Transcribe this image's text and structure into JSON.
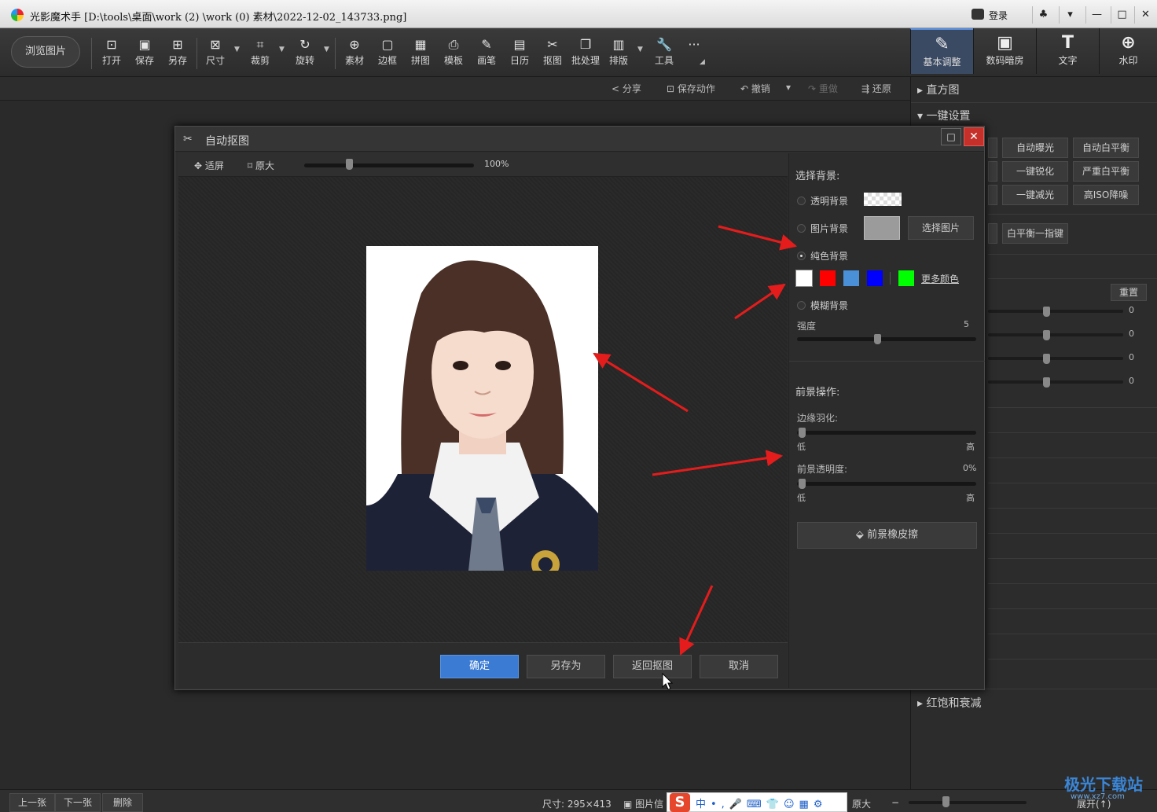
{
  "titlebar": {
    "title": "光影魔术手 [D:\\tools\\桌面\\work (2) \\work (0) 素材\\2022-12-02_143733.png]",
    "login": "登录",
    "buttons": [
      "♣",
      "▾",
      "—",
      "□",
      "✕"
    ]
  },
  "toolbar": {
    "browse": "浏览图片",
    "tools": [
      {
        "label": "打开",
        "icon": "⊡"
      },
      {
        "label": "保存",
        "icon": "▣"
      },
      {
        "label": "另存",
        "icon": "⊞"
      },
      {
        "label": "尺寸",
        "icon": "⊠"
      },
      {
        "label": "裁剪",
        "icon": "⌗"
      },
      {
        "label": "旋转",
        "icon": "↻"
      },
      {
        "label": "素材",
        "icon": "⊕"
      },
      {
        "label": "边框",
        "icon": "▢"
      },
      {
        "label": "拼图",
        "icon": "▦"
      },
      {
        "label": "模板",
        "icon": "⎙"
      },
      {
        "label": "画笔",
        "icon": "✎"
      },
      {
        "label": "日历",
        "icon": "▤"
      },
      {
        "label": "抠图",
        "icon": "✂"
      },
      {
        "label": "批处理",
        "icon": "❐"
      },
      {
        "label": "排版",
        "icon": "▥"
      },
      {
        "label": "工具",
        "icon": "🔧"
      },
      {
        "label": "",
        "icon": "···"
      }
    ],
    "tabs": [
      {
        "label": "基本调整",
        "icon": "✎"
      },
      {
        "label": "数码暗房",
        "icon": "▣"
      },
      {
        "label": "文字",
        "icon": "T"
      },
      {
        "label": "水印",
        "icon": "⊕"
      }
    ]
  },
  "subbar": {
    "share": "分享",
    "save_action": "保存动作",
    "undo": "撤销",
    "redo": "重做",
    "restore": "还原"
  },
  "right_panel": {
    "histogram": "直方图",
    "one_click": "一键设置",
    "buttons": [
      "自动曝光",
      "自动白平衡",
      "一键锐化",
      "严重白平衡",
      "一键减光",
      "高ISO降噪",
      "白平衡一指键"
    ],
    "reset": "重置",
    "slider_values": [
      "0",
      "0",
      "0",
      "0"
    ],
    "red_sat": "红饱和衰减"
  },
  "dialog": {
    "title": "自动抠图",
    "fit": "适屏",
    "original": "原大",
    "zoom_percent": "100%",
    "zoom_level": 0.25,
    "buttons": {
      "ok": "确定",
      "save_as": "另存为",
      "back": "返回抠图",
      "cancel": "取消"
    },
    "right": {
      "select_bg": "选择背景:",
      "transparent_bg": "透明背景",
      "image_bg": "图片背景",
      "choose_image": "选择图片",
      "solid_bg": "纯色背景",
      "colors": [
        "#ffffff",
        "#ff0000",
        "#4a90d9",
        "#0000ff",
        "#00ff00"
      ],
      "more_colors": "更多颜色",
      "blur_bg": "模糊背景",
      "strength": "强度",
      "strength_value": "5",
      "fg_ops": "前景操作:",
      "feather": "边缘羽化:",
      "low": "低",
      "high": "高",
      "fg_opacity": "前景透明度:",
      "fg_opacity_value": "0%",
      "eraser": "前景橡皮擦"
    }
  },
  "bottombar": {
    "prev": "上一张",
    "next": "下一张",
    "delete": "删除",
    "size": "尺寸: 295×413",
    "info": "图片信",
    "original": "原大",
    "expand": "展开(↑)",
    "ime": [
      "中",
      "•,",
      "🎤",
      "⌨",
      "👕",
      "☺",
      "▦",
      "⚙"
    ]
  },
  "watermark": {
    "text": "极光下载站",
    "sub": "www.xz7.com"
  }
}
